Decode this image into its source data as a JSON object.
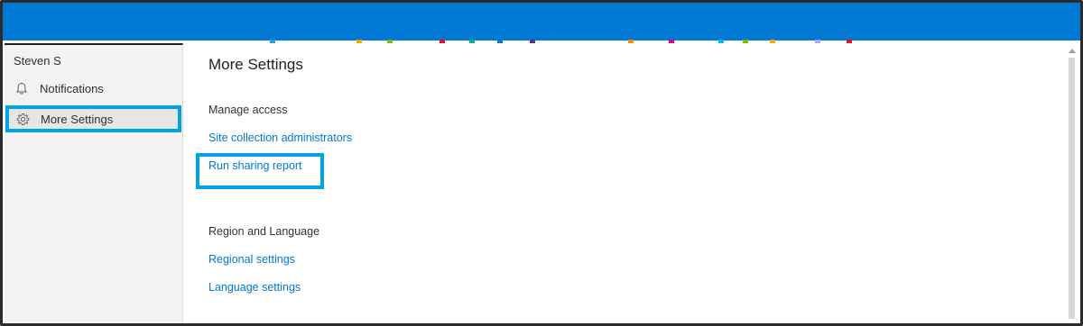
{
  "sidebar": {
    "user_name": "Steven S",
    "items": [
      {
        "label": "Notifications",
        "icon": "bell-icon"
      },
      {
        "label": "More Settings",
        "icon": "gear-icon",
        "selected": true
      }
    ]
  },
  "main": {
    "title": "More Settings",
    "sections": [
      {
        "heading": "Manage access",
        "links": [
          "Site collection administrators",
          "Run sharing report"
        ]
      },
      {
        "heading": "Region and Language",
        "links": [
          "Regional settings",
          "Language settings"
        ]
      }
    ]
  },
  "colors": {
    "header": "#0078d4",
    "link": "#0078d4",
    "highlight": "#00a2e8",
    "sidebar_bg": "#f3f2f1"
  }
}
